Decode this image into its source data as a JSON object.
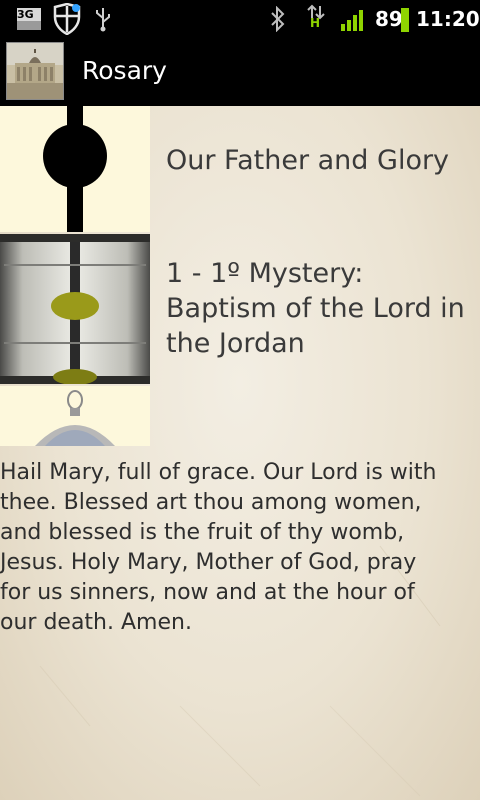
{
  "status_bar": {
    "network_label": "3G",
    "signal_letter": "H",
    "battery": "89",
    "time": "11:20"
  },
  "action_bar": {
    "title": "Rosary"
  },
  "rows": [
    {
      "label": "Our Father and Glory"
    },
    {
      "label_line1": "1 - 1º Mystery:",
      "label_line2": "Baptism of the Lord in",
      "label_line3": "the Jordan"
    }
  ],
  "prayer_lines": [
    "Hail Mary, full of grace. Our Lord is with",
    "thee. Blessed art thou among women,",
    "and blessed is the fruit of thy womb,",
    "Jesus. Holy Mary, Mother of God, pray",
    "for us sinners, now and at the hour of",
    "our death. Amen."
  ],
  "colors": {
    "status_bar": "#000000",
    "signal_green": "#8fd400",
    "paper": "#efe8d9",
    "bead_olive": "#9a9a1a"
  },
  "icons": [
    "3g-icon",
    "shield-icon",
    "usb-icon",
    "bluetooth-icon",
    "data-arrows-icon",
    "signal-icon",
    "battery-icon",
    "basilica-icon",
    "bead-icon",
    "medal-icon"
  ]
}
